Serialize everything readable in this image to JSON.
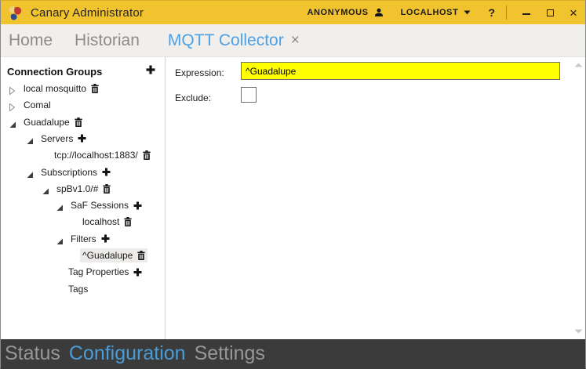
{
  "titlebar": {
    "title": "Canary Administrator",
    "user": "ANONYMOUS",
    "host": "LOCALHOST",
    "help": "?",
    "minimize": "minimize",
    "maximize": "maximize",
    "close": "×"
  },
  "tabs": [
    {
      "label": "Home",
      "active": false
    },
    {
      "label": "Historian",
      "active": false
    },
    {
      "label": "MQTT Collector",
      "active": true,
      "close": "×"
    }
  ],
  "tree": {
    "header": {
      "label": "Connection Groups",
      "action": "plus"
    },
    "rows": [
      {
        "label": "local mosquitto",
        "level": 1,
        "expander": "collapsed",
        "icon": "trash",
        "selected": false
      },
      {
        "label": "Comal",
        "level": 1,
        "expander": "collapsed",
        "icon": null,
        "selected": false
      },
      {
        "label": "Guadalupe",
        "level": 1,
        "expander": "expanded",
        "icon": "trash",
        "selected": false
      },
      {
        "label": "Servers",
        "level": 2,
        "expander": "expanded",
        "icon": "plus",
        "selected": false
      },
      {
        "label": "tcp://localhost:1883/",
        "level": 3,
        "expander": null,
        "icon": "trash",
        "selected": false
      },
      {
        "label": "Subscriptions",
        "level": 2,
        "expander": "expanded",
        "icon": "plus",
        "selected": false
      },
      {
        "label": "spBv1.0/#",
        "level": 3,
        "expander": "expanded",
        "icon": "trash",
        "selected": false
      },
      {
        "label": "SaF Sessions",
        "level": 4,
        "expander": "expanded",
        "icon": "plus",
        "selected": false
      },
      {
        "label": "localhost",
        "level": 5,
        "expander": null,
        "icon": "trash",
        "selected": false
      },
      {
        "label": "Filters",
        "level": 4,
        "expander": "expanded",
        "icon": "plus",
        "selected": false
      },
      {
        "label": "^Guadalupe",
        "level": 5,
        "expander": null,
        "icon": "trash",
        "selected": true
      },
      {
        "label": "Tag Properties",
        "level": 4,
        "expander": null,
        "icon": "plus",
        "selected": false
      },
      {
        "label": "Tags",
        "level": 4,
        "expander": null,
        "icon": null,
        "selected": false
      }
    ]
  },
  "form": {
    "expression_label": "Expression:",
    "expression_value": "^Guadalupe",
    "exclude_label": "Exclude:",
    "exclude_checked": false,
    "highlight_color": "#FFFF00"
  },
  "footer": {
    "items": [
      {
        "label": "Status",
        "active": false
      },
      {
        "label": "Configuration",
        "active": true
      },
      {
        "label": "Settings",
        "active": false
      }
    ]
  },
  "colors": {
    "titlebar_bg": "#F1C32F",
    "active_tab": "#4FA0E2",
    "footer_bg": "#3B3B3B",
    "footer_active": "#4A9CD6",
    "expression_bg": "#FFFF00",
    "selected_row_bg": "#EDEBE9"
  }
}
